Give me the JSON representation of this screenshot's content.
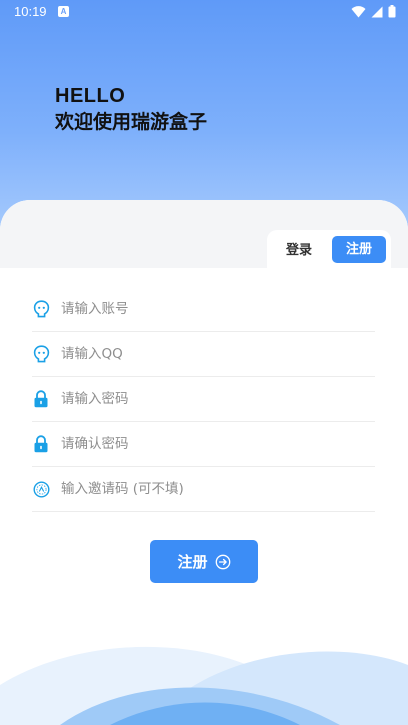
{
  "status_bar": {
    "time": "10:19",
    "notification_badge": "A"
  },
  "hero": {
    "hello": "HELLO",
    "welcome": "欢迎使用瑞游盒子"
  },
  "tabs": {
    "login": "登录",
    "register": "注册",
    "active": "register"
  },
  "form": {
    "fields": [
      {
        "icon": "user-icon",
        "placeholder": "请输入账号"
      },
      {
        "icon": "user-icon",
        "placeholder": "请输入QQ"
      },
      {
        "icon": "lock-icon",
        "placeholder": "请输入密码"
      },
      {
        "icon": "lock-icon",
        "placeholder": "请确认密码"
      },
      {
        "icon": "invite-icon",
        "placeholder": "输入邀请码 (可不填)"
      }
    ]
  },
  "submit": {
    "label": "注册"
  },
  "colors": {
    "accent": "#3c8df6",
    "hero_top": "#5f9af8",
    "field_icon": "#1aa0e6"
  }
}
